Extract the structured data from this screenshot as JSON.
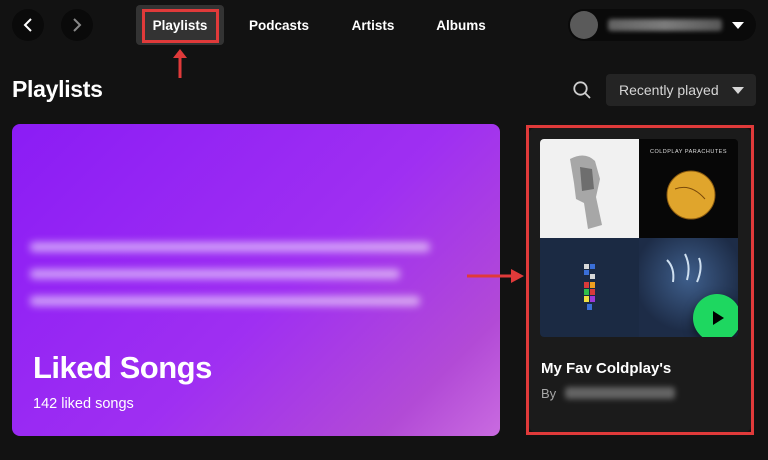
{
  "nav": {
    "back_icon": "chevron-left-icon",
    "forward_icon": "chevron-right-icon"
  },
  "tabs": [
    {
      "label": "Playlists",
      "active": true
    },
    {
      "label": "Podcasts",
      "active": false
    },
    {
      "label": "Artists",
      "active": false
    },
    {
      "label": "Albums",
      "active": false
    }
  ],
  "user": {
    "avatar_icon": "avatar-icon",
    "menu_icon": "caret-down-icon"
  },
  "header": {
    "title": "Playlists",
    "search_icon": "search-icon",
    "sort_label": "Recently played"
  },
  "liked_songs": {
    "title": "Liked Songs",
    "count": "142 liked songs"
  },
  "playlist": {
    "title": "My Fav Coldplay's",
    "by_label": "By",
    "cover_caption": "COLDPLAY PARACHUTES"
  },
  "colors": {
    "background": "#121212",
    "accent_green": "#1ed760",
    "liked_gradient_start": "#8b1cf5",
    "annotation_red": "#e03a3a"
  }
}
